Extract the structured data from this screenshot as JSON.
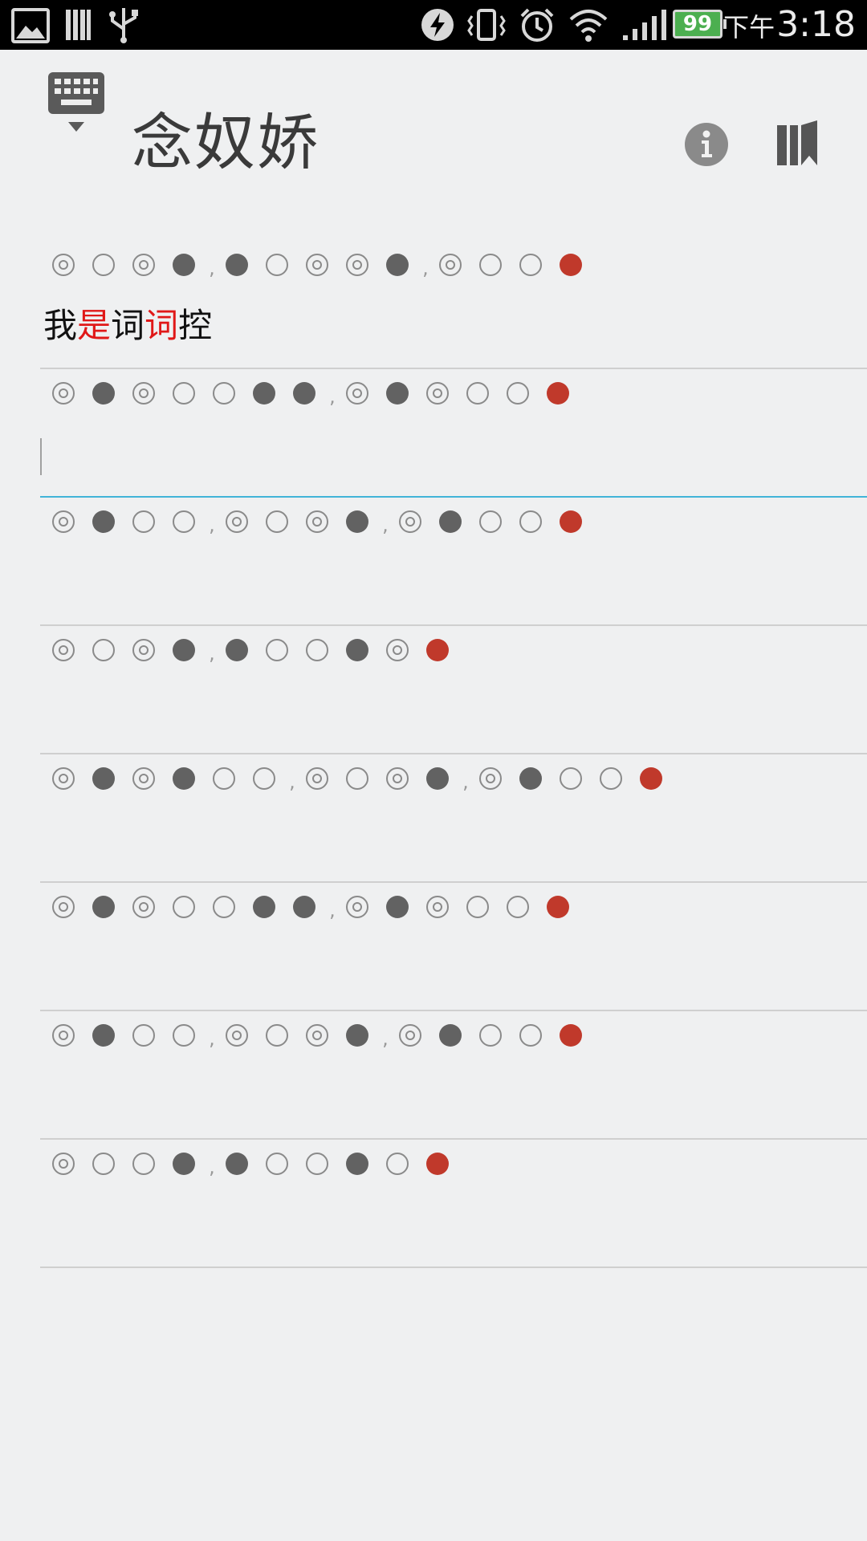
{
  "status_bar": {
    "battery_level": "99",
    "time_ampm": "下午",
    "time": "3:18",
    "icons": [
      "image-icon",
      "sd-card-icon",
      "usb-icon",
      "flash-icon",
      "vibrate-icon",
      "alarm-icon",
      "wifi-icon",
      "signal-icon",
      "battery-icon"
    ]
  },
  "header": {
    "title": "念奴娇",
    "left_icon": "keyboard-icon",
    "right_icons": [
      "info-icon",
      "bookmark-icon"
    ]
  },
  "legend_colors": {
    "ze": "#626262",
    "rhyme": "#c0392b",
    "active_underline": "#41b4d8"
  },
  "lines": [
    {
      "pattern": "◎○◎●,●○◎◎●,◎○○R",
      "text": [
        {
          "t": "我",
          "hl": false
        },
        {
          "t": "是",
          "hl": true
        },
        {
          "t": "词",
          "hl": false
        },
        {
          "t": "词",
          "hl": true
        },
        {
          "t": "控",
          "hl": false
        }
      ]
    },
    {
      "pattern": "◎●◎○○●●,◎●◎○○R",
      "text": [],
      "active": true
    },
    {
      "pattern": "◎●○○,◎○◎●,◎●○○R",
      "text": []
    },
    {
      "pattern": "◎○◎●,●○○●◎R",
      "text": []
    },
    {
      "pattern": "◎●◎●○○,◎○◎●,◎●○○R",
      "text": []
    },
    {
      "pattern": "◎●◎○○●●,◎●◎○○R",
      "text": []
    },
    {
      "pattern": "◎●○○,◎○◎●,◎●○○R",
      "text": []
    },
    {
      "pattern": "◎○○●,●○○●○R",
      "text": []
    }
  ]
}
